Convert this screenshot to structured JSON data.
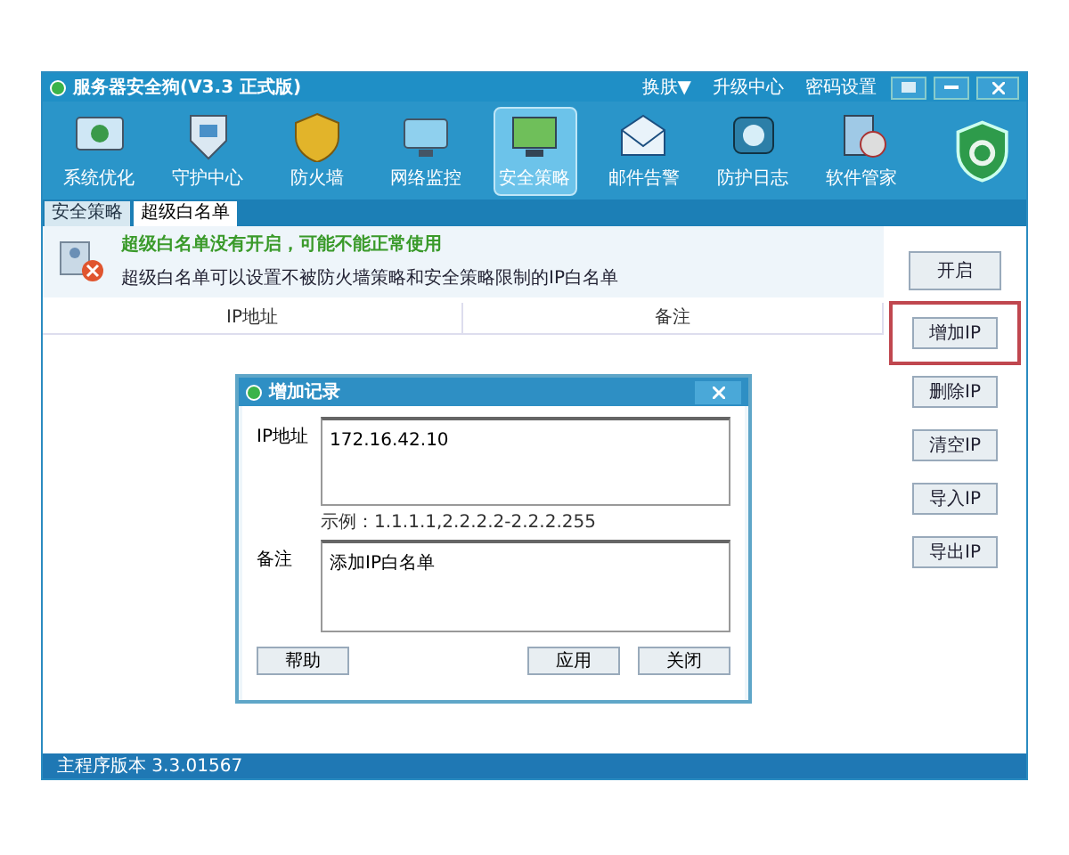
{
  "window": {
    "title": "服务器安全狗(V3.3 正式版)",
    "links": [
      "换肤▼",
      "升级中心",
      "密码设置"
    ]
  },
  "toolbar": [
    {
      "label": "系统优化",
      "selected": false
    },
    {
      "label": "守护中心",
      "selected": false
    },
    {
      "label": "防火墙",
      "selected": false
    },
    {
      "label": "网络监控",
      "selected": false
    },
    {
      "label": "安全策略",
      "selected": true
    },
    {
      "label": "邮件告警",
      "selected": false
    },
    {
      "label": "防护日志",
      "selected": false
    },
    {
      "label": "软件管家",
      "selected": false
    }
  ],
  "tabs": [
    {
      "label": "安全策略",
      "selected": false
    },
    {
      "label": "超级白名单",
      "selected": true
    }
  ],
  "notice": {
    "warning": "超级白名单没有开启，可能不能正常使用",
    "description": "超级白名单可以设置不被防火墙策略和安全策略限制的IP白名单"
  },
  "table": {
    "columns": [
      "IP地址",
      "备注"
    ]
  },
  "buttons": [
    {
      "label": "开启",
      "highlighted": false
    },
    {
      "label": "增加IP",
      "highlighted": true
    },
    {
      "label": "删除IP",
      "highlighted": false
    },
    {
      "label": "清空IP",
      "highlighted": false
    },
    {
      "label": "导入IP",
      "highlighted": false
    },
    {
      "label": "导出IP",
      "highlighted": false
    }
  ],
  "dialog": {
    "title": "增加记录",
    "ip_label": "IP地址",
    "ip_value": "172.16.42.10",
    "example": "示例：1.1.1.1,2.2.2.2-2.2.2.255",
    "note_label": "备注",
    "note_value": "添加IP白名单",
    "buttons": [
      "帮助",
      "应用",
      "关闭"
    ]
  },
  "status_bar": "主程序版本 3.3.01567"
}
